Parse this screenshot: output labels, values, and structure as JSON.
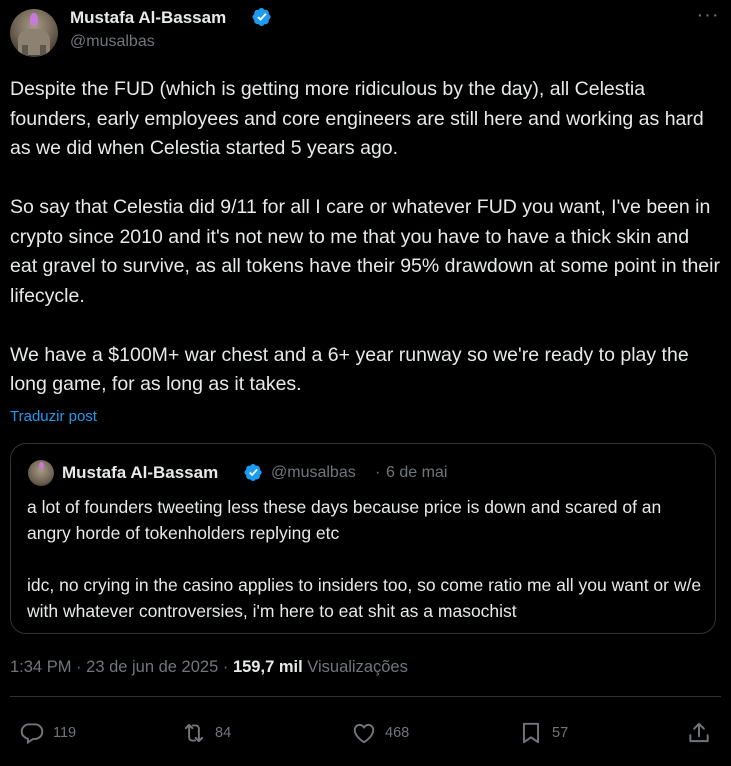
{
  "post": {
    "author": {
      "name": "Mustafa Al-Bassam",
      "handle": "@musalbas"
    },
    "paragraphs": [
      "Despite the FUD (which is getting more ridiculous by the day), all Celestia founders, early employees and core engineers are still here and working as hard as we did when Celestia started 5 years ago.",
      "So say that Celestia did 9/11 for all I care or whatever FUD you want, I've been in crypto since 2010 and it's not new to me that you have to have a thick skin and eat gravel to survive, as all tokens have their 95% drawdown at some point in their lifecycle.",
      "We have a $100M+ war chest and a 6+ year runway so we're ready to play the long game, for as long as it takes."
    ],
    "translate_label": "Traduzir post"
  },
  "quote": {
    "author": {
      "name": "Mustafa Al-Bassam",
      "handle": "@musalbas"
    },
    "separator": "·",
    "date": "6 de mai",
    "paragraphs": [
      "a lot of founders tweeting less these days because price is down and scared of an angry horde of tokenholders replying etc",
      "idc, no crying in the casino applies to insiders too, so come ratio me all you want or w/e with whatever controversies, i'm here to eat shit as a masochist"
    ]
  },
  "meta": {
    "time": "1:34 PM",
    "separator": "·",
    "date": "23 de jun de 2025",
    "views_count": "159,7 mil",
    "views_label": "Visualizações"
  },
  "actions": {
    "reply_count": "119",
    "retweet_count": "84",
    "like_count": "468",
    "bookmark_count": "57"
  },
  "more_label": "···",
  "icons": {
    "verified": "verified-badge-icon",
    "more": "more-options-icon",
    "reply": "reply-icon",
    "retweet": "retweet-icon",
    "like": "heart-icon",
    "bookmark": "bookmark-icon",
    "share": "share-icon"
  },
  "colors": {
    "background": "#000000",
    "text": "#e7e9ea",
    "muted": "#71767b",
    "accent": "#1d9bf0",
    "border": "#2f3336"
  }
}
